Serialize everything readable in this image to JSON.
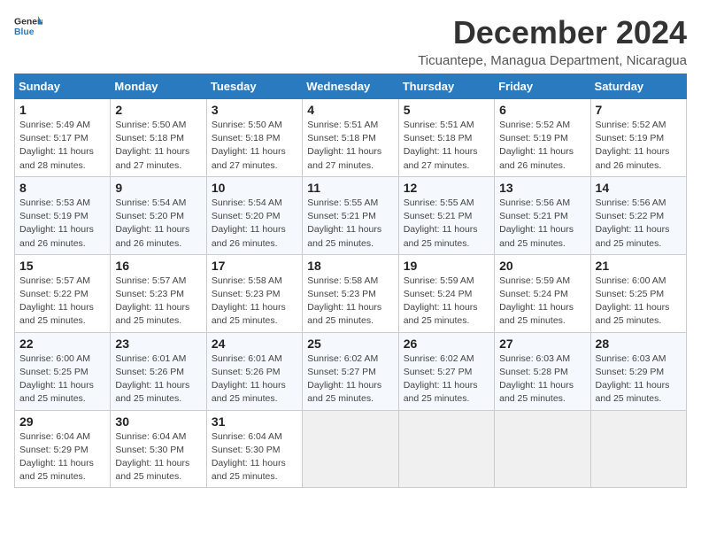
{
  "header": {
    "logo_general": "General",
    "logo_blue": "Blue",
    "month_title": "December 2024",
    "location": "Ticuantepe, Managua Department, Nicaragua"
  },
  "columns": [
    "Sunday",
    "Monday",
    "Tuesday",
    "Wednesday",
    "Thursday",
    "Friday",
    "Saturday"
  ],
  "weeks": [
    [
      {
        "day": "1",
        "sunrise": "5:49 AM",
        "sunset": "5:17 PM",
        "daylight": "11 hours and 28 minutes."
      },
      {
        "day": "2",
        "sunrise": "5:50 AM",
        "sunset": "5:18 PM",
        "daylight": "11 hours and 27 minutes."
      },
      {
        "day": "3",
        "sunrise": "5:50 AM",
        "sunset": "5:18 PM",
        "daylight": "11 hours and 27 minutes."
      },
      {
        "day": "4",
        "sunrise": "5:51 AM",
        "sunset": "5:18 PM",
        "daylight": "11 hours and 27 minutes."
      },
      {
        "day": "5",
        "sunrise": "5:51 AM",
        "sunset": "5:18 PM",
        "daylight": "11 hours and 27 minutes."
      },
      {
        "day": "6",
        "sunrise": "5:52 AM",
        "sunset": "5:19 PM",
        "daylight": "11 hours and 26 minutes."
      },
      {
        "day": "7",
        "sunrise": "5:52 AM",
        "sunset": "5:19 PM",
        "daylight": "11 hours and 26 minutes."
      }
    ],
    [
      {
        "day": "8",
        "sunrise": "5:53 AM",
        "sunset": "5:19 PM",
        "daylight": "11 hours and 26 minutes."
      },
      {
        "day": "9",
        "sunrise": "5:54 AM",
        "sunset": "5:20 PM",
        "daylight": "11 hours and 26 minutes."
      },
      {
        "day": "10",
        "sunrise": "5:54 AM",
        "sunset": "5:20 PM",
        "daylight": "11 hours and 26 minutes."
      },
      {
        "day": "11",
        "sunrise": "5:55 AM",
        "sunset": "5:21 PM",
        "daylight": "11 hours and 25 minutes."
      },
      {
        "day": "12",
        "sunrise": "5:55 AM",
        "sunset": "5:21 PM",
        "daylight": "11 hours and 25 minutes."
      },
      {
        "day": "13",
        "sunrise": "5:56 AM",
        "sunset": "5:21 PM",
        "daylight": "11 hours and 25 minutes."
      },
      {
        "day": "14",
        "sunrise": "5:56 AM",
        "sunset": "5:22 PM",
        "daylight": "11 hours and 25 minutes."
      }
    ],
    [
      {
        "day": "15",
        "sunrise": "5:57 AM",
        "sunset": "5:22 PM",
        "daylight": "11 hours and 25 minutes."
      },
      {
        "day": "16",
        "sunrise": "5:57 AM",
        "sunset": "5:23 PM",
        "daylight": "11 hours and 25 minutes."
      },
      {
        "day": "17",
        "sunrise": "5:58 AM",
        "sunset": "5:23 PM",
        "daylight": "11 hours and 25 minutes."
      },
      {
        "day": "18",
        "sunrise": "5:58 AM",
        "sunset": "5:23 PM",
        "daylight": "11 hours and 25 minutes."
      },
      {
        "day": "19",
        "sunrise": "5:59 AM",
        "sunset": "5:24 PM",
        "daylight": "11 hours and 25 minutes."
      },
      {
        "day": "20",
        "sunrise": "5:59 AM",
        "sunset": "5:24 PM",
        "daylight": "11 hours and 25 minutes."
      },
      {
        "day": "21",
        "sunrise": "6:00 AM",
        "sunset": "5:25 PM",
        "daylight": "11 hours and 25 minutes."
      }
    ],
    [
      {
        "day": "22",
        "sunrise": "6:00 AM",
        "sunset": "5:25 PM",
        "daylight": "11 hours and 25 minutes."
      },
      {
        "day": "23",
        "sunrise": "6:01 AM",
        "sunset": "5:26 PM",
        "daylight": "11 hours and 25 minutes."
      },
      {
        "day": "24",
        "sunrise": "6:01 AM",
        "sunset": "5:26 PM",
        "daylight": "11 hours and 25 minutes."
      },
      {
        "day": "25",
        "sunrise": "6:02 AM",
        "sunset": "5:27 PM",
        "daylight": "11 hours and 25 minutes."
      },
      {
        "day": "26",
        "sunrise": "6:02 AM",
        "sunset": "5:27 PM",
        "daylight": "11 hours and 25 minutes."
      },
      {
        "day": "27",
        "sunrise": "6:03 AM",
        "sunset": "5:28 PM",
        "daylight": "11 hours and 25 minutes."
      },
      {
        "day": "28",
        "sunrise": "6:03 AM",
        "sunset": "5:29 PM",
        "daylight": "11 hours and 25 minutes."
      }
    ],
    [
      {
        "day": "29",
        "sunrise": "6:04 AM",
        "sunset": "5:29 PM",
        "daylight": "11 hours and 25 minutes."
      },
      {
        "day": "30",
        "sunrise": "6:04 AM",
        "sunset": "5:30 PM",
        "daylight": "11 hours and 25 minutes."
      },
      {
        "day": "31",
        "sunrise": "6:04 AM",
        "sunset": "5:30 PM",
        "daylight": "11 hours and 25 minutes."
      },
      null,
      null,
      null,
      null
    ]
  ]
}
